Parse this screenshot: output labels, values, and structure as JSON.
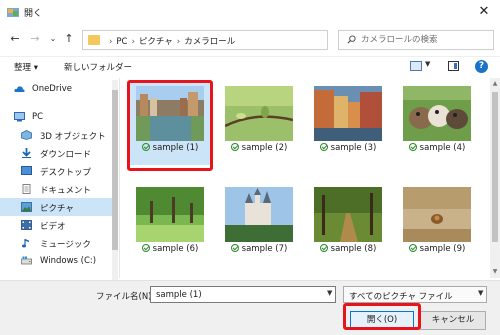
{
  "window": {
    "title": "開く",
    "close_glyph": "✕"
  },
  "nav": {
    "back_glyph": "←",
    "forward_glyph": "→",
    "recent_glyph": "⌄",
    "up_glyph": "↑",
    "breadcrumbs": [
      "PC",
      "ピクチャ",
      "カメラロール"
    ],
    "sep": "›",
    "dropdown_glyph": "⌄",
    "refresh_glyph": "↻",
    "search_placeholder": "カメラロールの検索"
  },
  "toolbar": {
    "organize_label": "整理 ▾",
    "new_folder_label": "新しいフォルダー",
    "help_glyph": "?"
  },
  "sidebar": {
    "items": [
      {
        "label": "OneDrive",
        "icon": "cloud-icon"
      },
      {
        "label": "PC",
        "icon": "computer-icon"
      },
      {
        "label": "3D オブジェクト",
        "icon": "3d-objects-icon"
      },
      {
        "label": "ダウンロード",
        "icon": "download-icon"
      },
      {
        "label": "デスクトップ",
        "icon": "desktop-icon"
      },
      {
        "label": "ドキュメント",
        "icon": "document-icon"
      },
      {
        "label": "ピクチャ",
        "icon": "pictures-icon"
      },
      {
        "label": "ビデオ",
        "icon": "video-icon"
      },
      {
        "label": "ミュージック",
        "icon": "music-icon"
      },
      {
        "label": "Windows (C:)",
        "icon": "drive-icon"
      }
    ],
    "selected_index": 6
  },
  "files": [
    {
      "name": "sample (1)",
      "selected": true
    },
    {
      "name": "sample (2)"
    },
    {
      "name": "sample (3)"
    },
    {
      "name": "sample (4)"
    },
    {
      "name": "sample (6)"
    },
    {
      "name": "sample (7)"
    },
    {
      "name": "sample (8)"
    },
    {
      "name": "sample (9)"
    }
  ],
  "bottom": {
    "filename_label": "ファイル名(N):",
    "filename_value": "sample (1)",
    "filetype_value": "すべてのピクチャ ファイル",
    "open_label": "開く(O)",
    "cancel_label": "キャンセル"
  },
  "colors": {
    "highlight_red": "#e8141c",
    "selection_blue": "#cce4f7",
    "accent_blue": "#0078d7"
  }
}
